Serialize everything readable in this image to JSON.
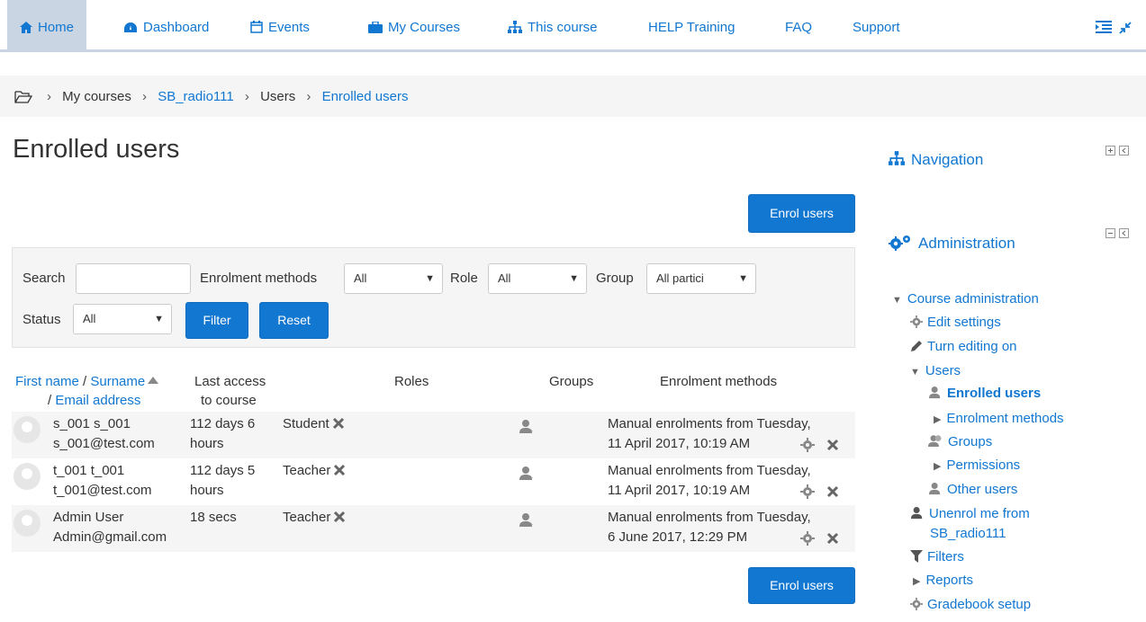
{
  "nav": {
    "items": [
      {
        "label": "Home",
        "icon": "home-icon"
      },
      {
        "label": "Dashboard",
        "icon": "dashboard-icon"
      },
      {
        "label": "Events",
        "icon": "calendar-icon"
      },
      {
        "label": "My Courses",
        "icon": "briefcase-icon"
      },
      {
        "label": "This course",
        "icon": "sitemap-icon"
      },
      {
        "label": "HELP Training"
      },
      {
        "label": "FAQ"
      },
      {
        "label": "Support"
      }
    ]
  },
  "breadcrumb": {
    "items": [
      "My courses",
      "SB_radio111",
      "Users",
      "Enrolled users"
    ]
  },
  "page": {
    "title": "Enrolled users",
    "enrol_button": "Enrol users"
  },
  "filter": {
    "search_label": "Search",
    "search_value": "",
    "methods_label": "Enrolment methods",
    "methods_value": "All",
    "role_label": "Role",
    "role_value": "All",
    "group_label": "Group",
    "group_value": "All partici",
    "status_label": "Status",
    "status_value": "All",
    "filter_button": "Filter",
    "reset_button": "Reset"
  },
  "table": {
    "headers": {
      "first_name": "First name",
      "slash1": " / ",
      "surname": "Surname",
      "slash2": "/ ",
      "email": "Email address",
      "last_access_1": "Last access",
      "last_access_2": "to course",
      "roles": "Roles",
      "groups": "Groups",
      "methods": "Enrolment methods"
    },
    "rows": [
      {
        "name": "s_001 s_001",
        "email": "s_001@test.com",
        "access1": "112 days 6",
        "access2": "hours",
        "role": "Student",
        "method1": "Manual enrolments from Tuesday,",
        "method2": "11 April 2017, 10:19 AM"
      },
      {
        "name": "t_001 t_001",
        "email": "t_001@test.com",
        "access1": "112 days 5",
        "access2": "hours",
        "role": "Teacher",
        "method1": "Manual enrolments from Tuesday,",
        "method2": "11 April 2017, 10:19 AM"
      },
      {
        "name": "Admin User",
        "email": "Admin@gmail.com",
        "access1": "18 secs",
        "access2": "",
        "role": "Teacher",
        "method1": "Manual enrolments from Tuesday,",
        "method2": "6 June 2017, 12:29 PM"
      }
    ]
  },
  "sidebar": {
    "navigation_title": "Navigation",
    "administration_title": "Administration",
    "tree": {
      "course_admin": "Course administration",
      "edit_settings": "Edit settings",
      "turn_editing": "Turn editing on",
      "users": "Users",
      "enrolled_users": "Enrolled users",
      "enrolment_methods": "Enrolment methods",
      "groups": "Groups",
      "permissions": "Permissions",
      "other_users": "Other users",
      "unenrol_1": "Unenrol me from",
      "unenrol_2": "SB_radio111",
      "filters": "Filters",
      "reports": "Reports",
      "gradebook": "Gradebook setup"
    }
  },
  "colors": {
    "link": "#1177d1",
    "button": "#1177d1",
    "nav_active": "#c9d5e2"
  }
}
